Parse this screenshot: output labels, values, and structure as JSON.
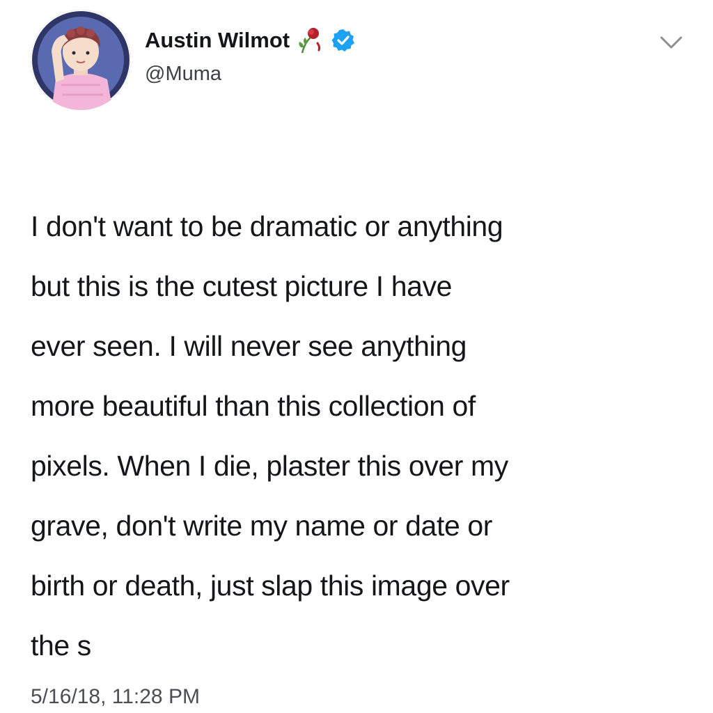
{
  "tweet": {
    "author": {
      "display_name": "Austin Wilmot",
      "handle": "@Muma",
      "avatar_icon": "avatar-illustration",
      "name_emoji_icon": "wilted-rose-icon",
      "verified_icon": "verified-badge-icon"
    },
    "menu_icon": "chevron-down-icon",
    "text_lines": [
      "I don't want to be dramatic or anything",
      "but this is the cutest picture I have",
      "ever seen. I will never see anything",
      "more beautiful than this collection of",
      "pixels. When I die, plaster this over my",
      "grave, don't write my name or date or",
      "birth or death, just slap this image over",
      "the s"
    ],
    "timestamp": "5/16/18, 11:28 PM",
    "colors": {
      "text": "#14171a",
      "muted": "#4a4f55",
      "verified": "#1da1f2",
      "caret": "#8a8f94"
    }
  }
}
